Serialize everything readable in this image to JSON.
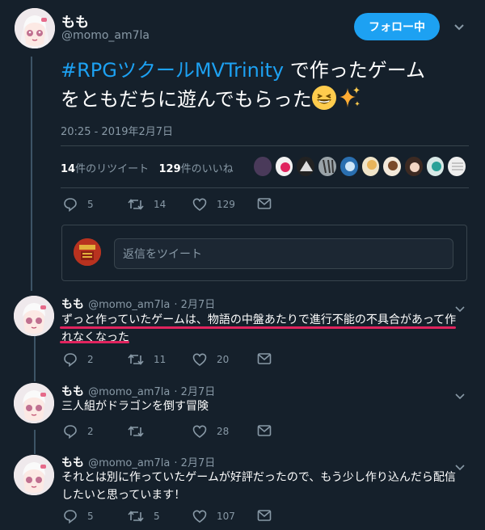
{
  "main_tweet": {
    "author_name": "もも",
    "author_handle": "@momo_am7la",
    "follow_label": "フォロー中",
    "hashtag": "#RPGツクールMVTrinity",
    "text_line1_rest": " で作ったゲーム",
    "text_line2": "をともだちに遊んでもらった",
    "timestamp": "20:25 - 2019年2月7日",
    "retweets_count": "14",
    "retweets_label": "件のリツイート",
    "likes_count": "129",
    "likes_label": "件のいいね",
    "actions": {
      "replies": "5",
      "retweets": "14",
      "likes": "129"
    },
    "emoji": [
      "grinning-squinting-face",
      "sparkles"
    ]
  },
  "reply_composer": {
    "placeholder": "返信をツイート"
  },
  "replies": [
    {
      "name": "もも",
      "handle": "@momo_am7la",
      "date": "· 2月7日",
      "text_line1": "ずっと作っていたゲームは、物語の中盤あたりで進行不能の不具合があって作",
      "text_line2": "れなくなった",
      "replies": "2",
      "retweets": "11",
      "likes": "20",
      "underline_color": "#e0245e"
    },
    {
      "name": "もも",
      "handle": "@momo_am7la",
      "date": "· 2月7日",
      "text_line1": "三人組がドラゴンを倒す冒険",
      "replies": "2",
      "retweets": "",
      "likes": "28"
    },
    {
      "name": "もも",
      "handle": "@momo_am7la",
      "date": "· 2月7日",
      "text_line1": "それとは別に作っていたゲームが好評だったので、もう少し作り込んだら配信",
      "text_line2": "したいと思っています！",
      "replies": "5",
      "retweets": "5",
      "likes": "107"
    }
  ],
  "colors": {
    "background": "#15202b",
    "accent": "#1da1f2",
    "muted": "#8899a6",
    "border": "#38444d",
    "annotation": "#e0245e"
  }
}
